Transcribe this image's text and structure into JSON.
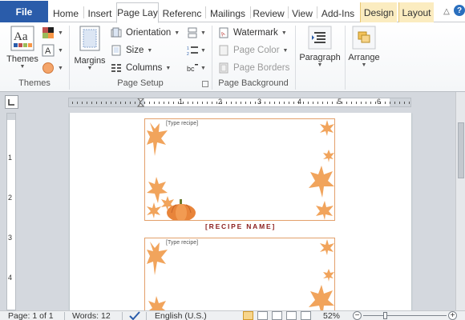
{
  "ribbon_tabs": {
    "file": "File",
    "home": "Home",
    "insert": "Insert",
    "page_layout": "Page Lay",
    "references": "Referenc",
    "mailings": "Mailings",
    "review": "Review",
    "view": "View",
    "addins": "Add-Ins",
    "design": "Design",
    "layout": "Layout"
  },
  "groups": {
    "themes": {
      "label": "Themes",
      "themes_button": "Themes"
    },
    "page_setup": {
      "label": "Page Setup",
      "margins": "Margins",
      "orientation": "Orientation",
      "size": "Size",
      "columns": "Columns"
    },
    "page_background": {
      "label": "Page Background",
      "watermark": "Watermark",
      "page_color": "Page Color",
      "page_borders": "Page Borders"
    },
    "paragraph": {
      "label": "Paragraph"
    },
    "arrange": {
      "label": "Arrange"
    }
  },
  "ruler": {
    "h_numbers": [
      "1",
      "2",
      "3",
      "4",
      "5",
      "6"
    ],
    "v_numbers": [
      "1",
      "2",
      "3",
      "4"
    ]
  },
  "document": {
    "card1_placeholder": "[Type recipe]",
    "card2_placeholder": "[Type recipe]",
    "recipe_name": "[RECIPE NAME]"
  },
  "status": {
    "page": "Page: 1 of 1",
    "words": "Words: 12",
    "language": "English (U.S.)",
    "zoom": "52%"
  },
  "colors": {
    "file_tab": "#2a5caa",
    "context_tabs": "#fbecc0",
    "leaf": "#f1a45c",
    "pumpkin": "#e8843a",
    "recipe_name": "#8b1e1e"
  }
}
